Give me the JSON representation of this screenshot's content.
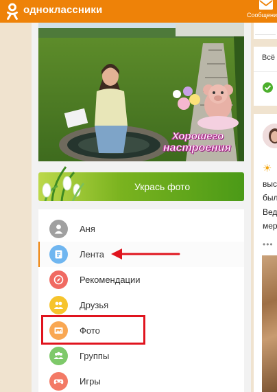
{
  "header": {
    "brand": "одноклассники",
    "messages_label": "Сообщения",
    "accent": "#ee8208"
  },
  "cover": {
    "overlay_line1": "Хорошего",
    "overlay_line2": "настроения"
  },
  "decorate_button": {
    "label": "Укрась фото",
    "color": "#5fa51c"
  },
  "menu": {
    "items": [
      {
        "label": "Аня",
        "icon": "user-icon",
        "color": "#a0a0a0"
      },
      {
        "label": "Лента",
        "icon": "feed-icon",
        "color": "#70b6f0"
      },
      {
        "label": "Рекомендации",
        "icon": "compass-icon",
        "color": "#f06a62"
      },
      {
        "label": "Друзья",
        "icon": "friends-icon",
        "color": "#f6c42d"
      },
      {
        "label": "Фото",
        "icon": "photo-icon",
        "color": "#f9a752"
      },
      {
        "label": "Группы",
        "icon": "groups-icon",
        "color": "#7ec96a"
      },
      {
        "label": "Игры",
        "icon": "games-icon",
        "color": "#f37a66"
      }
    ]
  },
  "right": {
    "tab_label": "Всё",
    "post_lines": [
      "выс",
      "был",
      "Вед",
      "мер"
    ],
    "dots": "•••"
  },
  "annotation_color": "#e0141e"
}
